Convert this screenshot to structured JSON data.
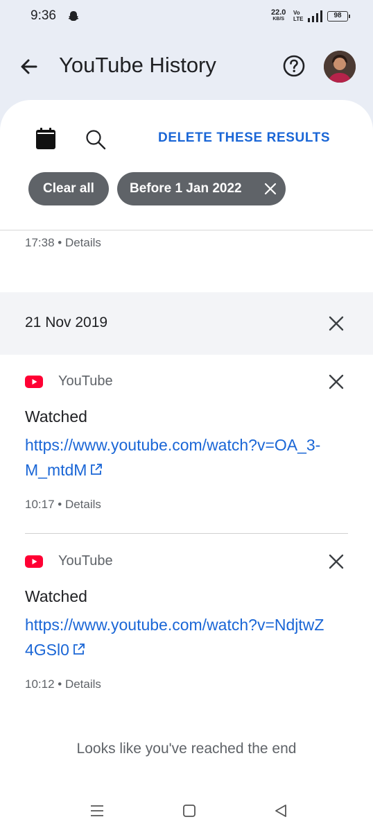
{
  "status_bar": {
    "time": "9:36",
    "net_speed": "22.0",
    "net_unit": "KB/S",
    "volte_top": "Vo",
    "volte_bottom": "LTE",
    "battery": "98"
  },
  "app_bar": {
    "title": "YouTube History",
    "icons": [
      "back-arrow-icon",
      "help-icon",
      "avatar"
    ]
  },
  "toolbar": {
    "delete_label": "DELETE THESE RESULTS",
    "icons": [
      "calendar-icon",
      "search-icon"
    ]
  },
  "chips": {
    "clear_all": "Clear all",
    "date_filter": "Before 1 Jan 2022"
  },
  "previous_entry": {
    "time": "17:38",
    "details": "Details"
  },
  "day_group": {
    "date": "21 Nov 2019"
  },
  "entries": [
    {
      "source": "YouTube",
      "action": "Watched",
      "link": "https://www.youtube.com/watch?v=OA_3-M_mtdM",
      "time": "10:17",
      "details": "Details"
    },
    {
      "source": "YouTube",
      "action": "Watched",
      "link": "https://www.youtube.com/watch?v=NdjtwZ4GSl0",
      "time": "10:12",
      "details": "Details"
    }
  ],
  "end_message": "Looks like you've reached the end",
  "colors": {
    "accent": "#1a66d6",
    "chip": "#5f6368",
    "youtube_red": "#ff0033",
    "header_bg": "#e9edf5"
  }
}
